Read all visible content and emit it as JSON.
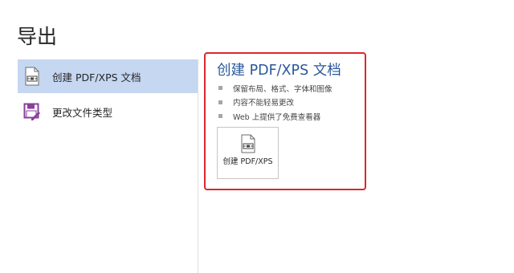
{
  "header": {
    "title": "导出"
  },
  "sidebar": {
    "items": [
      {
        "label": "创建 PDF/XPS 文档",
        "icon": "pdf-document-icon",
        "selected": true
      },
      {
        "label": "更改文件类型",
        "icon": "change-file-type-icon",
        "selected": false
      }
    ]
  },
  "main": {
    "title": "创建 PDF/XPS 文档",
    "bullets": [
      "保留布局、格式、字体和图像",
      "内容不能轻易更改",
      "Web 上提供了免费查看器"
    ],
    "create_button": {
      "label": "创建 PDF/XPS",
      "icon": "pdf-document-icon"
    }
  },
  "colors": {
    "selected_bg": "#c5d7f1",
    "title_blue": "#2b579a",
    "highlight_border": "#d9282d",
    "file_type_icon": "#8a3f9e"
  }
}
